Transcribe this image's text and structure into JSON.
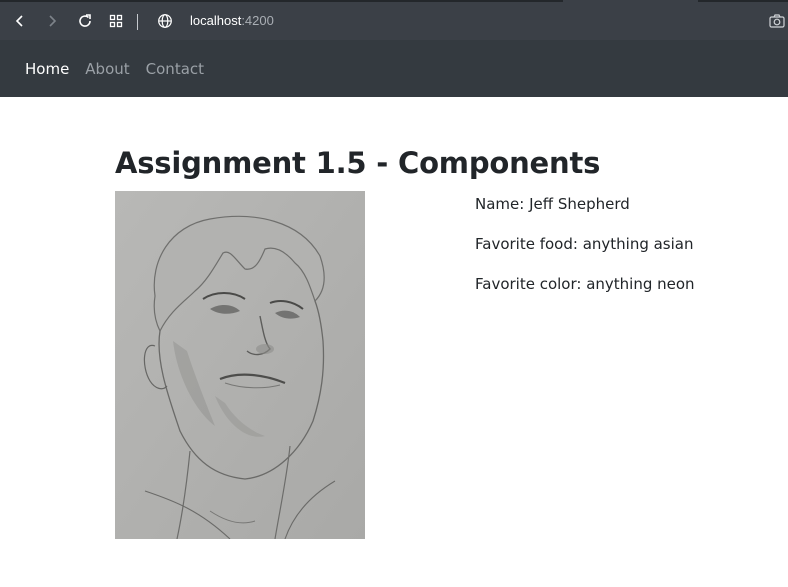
{
  "browser": {
    "url_host": "localhost",
    "url_port": ":4200",
    "icons": [
      "back-icon",
      "forward-icon",
      "reload-icon",
      "apps-grid-icon",
      "globe-icon",
      "camera-icon"
    ]
  },
  "navbar": {
    "links": [
      {
        "label": "Home",
        "active": true
      },
      {
        "label": "About",
        "active": false
      },
      {
        "label": "Contact",
        "active": false
      }
    ]
  },
  "main": {
    "title": "Assignment 1.5 - Components",
    "details": {
      "name": "Name: Jeff Shepherd",
      "food": "Favorite food: anything asian",
      "color": "Favorite color: anything neon"
    }
  },
  "colors": {
    "browser_bar": "#3b4047",
    "navbar": "#343a40",
    "nav_active": "#ffffff",
    "nav_inactive": "#9aa0a6",
    "text": "#212529"
  }
}
